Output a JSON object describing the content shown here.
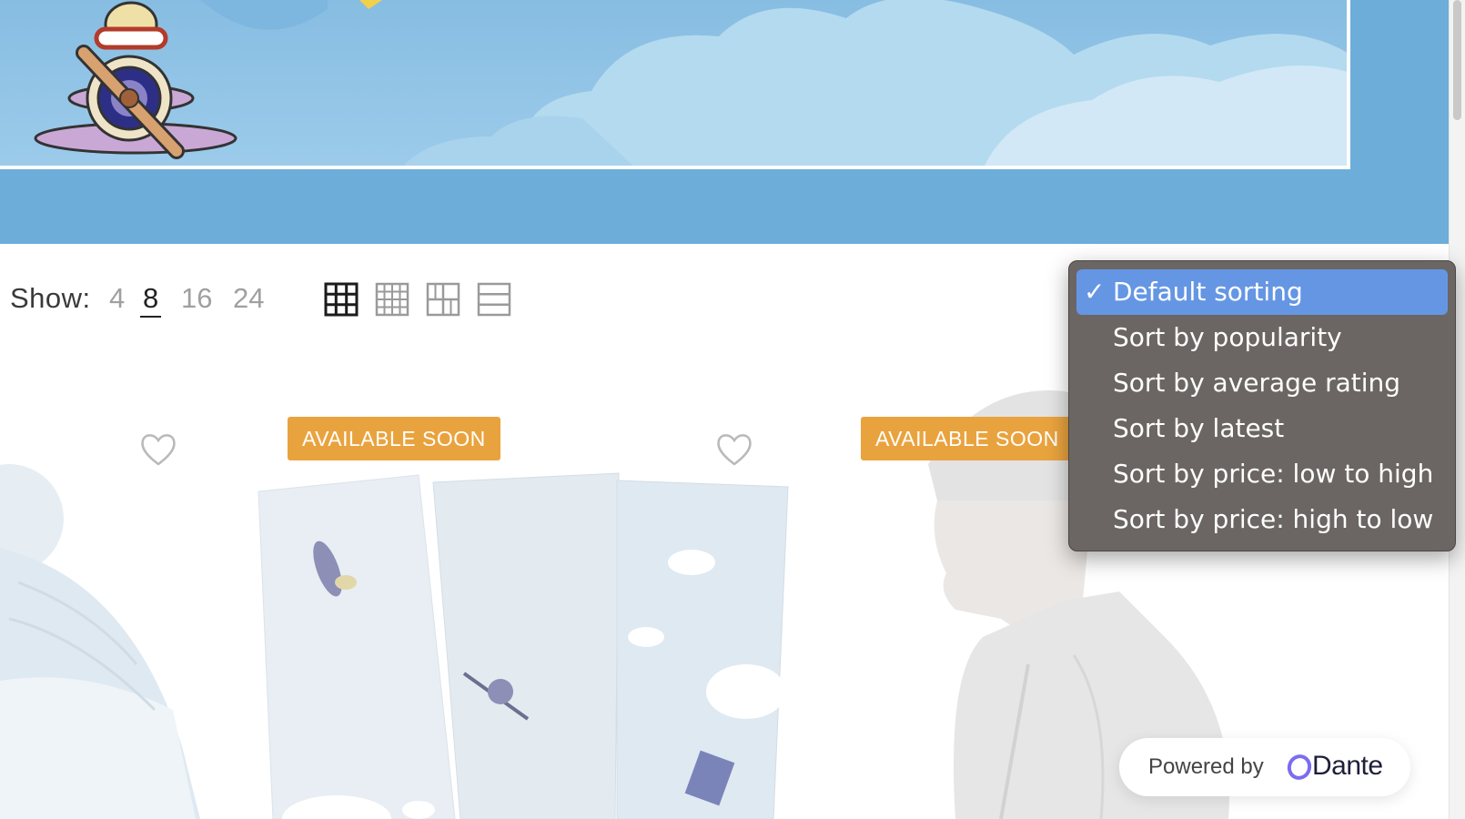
{
  "toolbar": {
    "show_label": "Show:",
    "per_page_options": [
      "4",
      "8",
      "16",
      "24"
    ],
    "per_page_selected": "8",
    "view_modes": [
      "grid-4-icon",
      "grid-5-icon",
      "grid-3-icon",
      "list-icon"
    ],
    "active_view": "grid-4-icon"
  },
  "sort_dropdown": {
    "selected_index": 0,
    "checkmark": "✓",
    "options": [
      "Default sorting",
      "Sort by popularity",
      "Sort by average rating",
      "Sort by latest",
      "Sort by price: low to high",
      "Sort by price: high to low"
    ]
  },
  "products": [
    {
      "badge": "",
      "image": "knit-pom-beanie"
    },
    {
      "badge": "AVAILABLE SOON",
      "image": "airplane-pattern-cards"
    },
    {
      "badge": "AVAILABLE SOON",
      "image": "man-in-white-beanie"
    }
  ],
  "widget": {
    "powered_by": "Powered by",
    "brand": "Dante"
  },
  "colors": {
    "hero_blue": "#6dadda",
    "badge_orange": "#e9a33e",
    "dropdown_bg": "#6b6663",
    "dropdown_selected": "#6596e4",
    "dante_purple": "#7b6cf0"
  }
}
